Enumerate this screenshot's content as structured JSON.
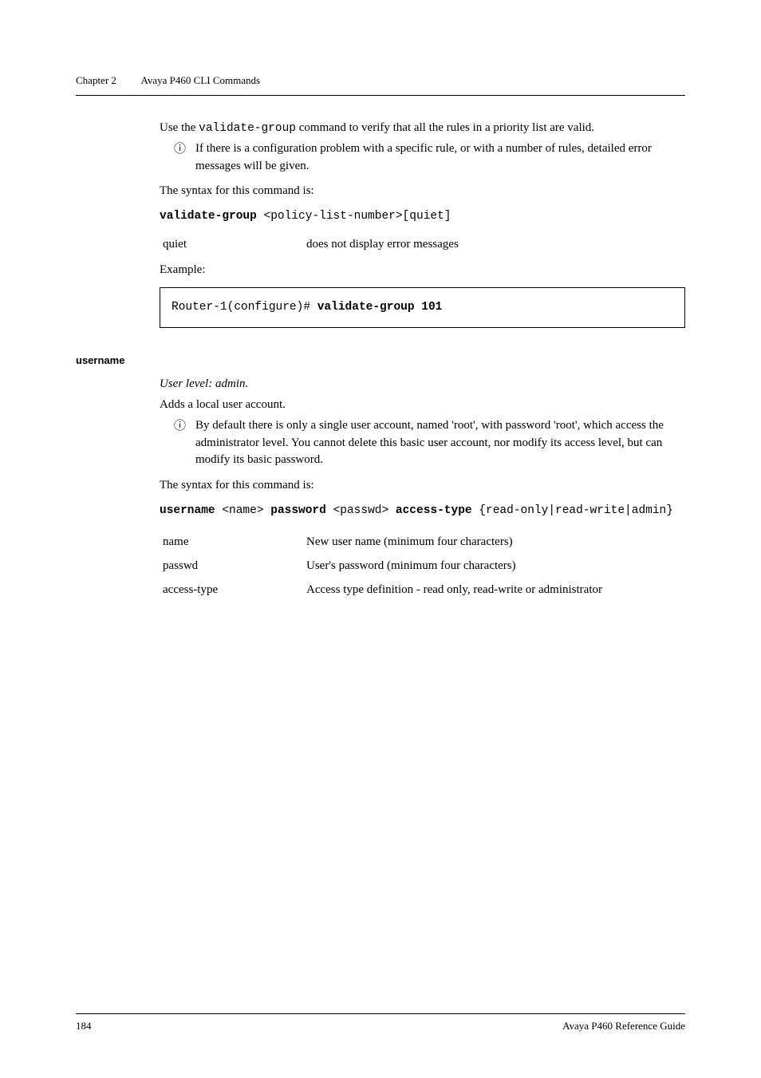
{
  "runningHead": {
    "chapter": "Chapter 2",
    "title": "Avaya P460 CLI Commands"
  },
  "sec1": {
    "intro_a": "Use the ",
    "intro_code": "validate-group",
    "intro_b": " command to verify that all the rules in a priority list are valid.",
    "bullet_glyph": "ⓘ",
    "bullet_text": "If there is a configuration problem with a specific rule, or with a number of rules, detailed error messages will be given.",
    "syntax_lead": "The syntax for this command is:",
    "syntax_bold": "validate-group",
    "syntax_rest": " <policy-list-number>[quiet]",
    "param": {
      "name": "quiet",
      "desc": "does not display error messages"
    },
    "example_label": "Example:",
    "example_code_a": "Router-1(configure)# ",
    "example_code_b": "validate-group 101"
  },
  "sec2": {
    "heading": "username",
    "userlevel": "User level: admin.",
    "desc": "Adds a local user account.",
    "bullet_glyph": "ⓘ",
    "bullet_text": "By default there is only a single user account, named 'root', with password 'root', which access the administrator level. You cannot delete this basic user account, nor modify its access level, but can modify its basic password.",
    "syntax_lead": "The syntax for this command is:",
    "syntax_b1": "username",
    "syntax_t1": " <name> ",
    "syntax_b2": "password",
    "syntax_t2": " <passwd> ",
    "syntax_b3": "access-type",
    "syntax_t3": " {read-only|read-write|admin}",
    "params": [
      {
        "name": "name",
        "desc": "New user name (minimum four characters)"
      },
      {
        "name": "passwd",
        "desc": "User's password (minimum four characters)"
      },
      {
        "name": "access-type",
        "desc": "Access type definition - read only, read-write or administrator"
      }
    ]
  },
  "footer": {
    "page": "184",
    "doc": "Avaya P460 Reference Guide"
  }
}
